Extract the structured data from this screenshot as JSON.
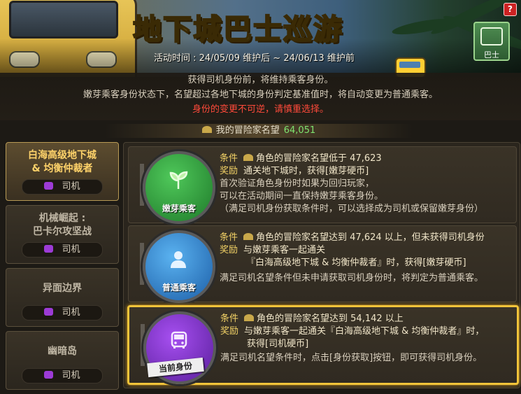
{
  "banner": {
    "title_part1": "地下城",
    "title_part2": "巴士",
    "title_part3": "巡游",
    "period": "活动时间 : 24/05/09 维护后 ~ 24/06/13 维护前",
    "help_label": "?",
    "bus_button_label": "巴士"
  },
  "notice": {
    "line1": "获得司机身份前，将维持乘客身份。",
    "line2": "嫩芽乘客身份状态下，名望超过各地下城的身份判定基准值时，将自动变更为普通乘客。",
    "line3_warning": "身份的变更不可逆，请慎重选择。"
  },
  "reputation": {
    "label": "我的冒险家名望",
    "value": "64,051"
  },
  "sidebar": {
    "items": [
      {
        "line1": "白海高级地下城",
        "line2": "& 均衡仲裁者",
        "role": "司机",
        "active": true
      },
      {
        "line1": "机械崛起 :",
        "line2": "巴卡尔攻坚战",
        "role": "司机",
        "active": false
      },
      {
        "line1": "异面边界",
        "line2": "",
        "role": "司机",
        "active": false
      },
      {
        "line1": "幽暗岛",
        "line2": "",
        "role": "司机",
        "active": false
      }
    ]
  },
  "cards": [
    {
      "badge_label": "嫩芽乘客",
      "color": "#2f9a3a",
      "condition_label": "条件",
      "condition_text": "角色的冒险家名望低于 47,623",
      "reward_label": "奖励",
      "reward_text": "通关地下城时，获得[嫩芽硬币]",
      "extra": [
        "首次验证角色身份时如果为回归玩家，",
        "可以在活动期间一直保持嫩芽乘客身份。",
        "（满足司机身份获取条件时，可以选择成为司机或保留嫩芽身份）"
      ]
    },
    {
      "badge_label": "普通乘客",
      "color": "#2a7fd0",
      "condition_label": "条件",
      "condition_text": "角色的冒险家名望达到 47,624 以上，但未获得司机身份",
      "reward_label": "奖励",
      "reward_text": "与嫩芽乘客一起通关",
      "reward_text2": "『白海高级地下城 & 均衡仲裁者』时，获得[嫩芽硬币]",
      "extra": [
        "满足司机名望条件但未申请获取司机身份时，将判定为普通乘客。"
      ]
    },
    {
      "badge_label": "当前身份",
      "color": "#7a2fc6",
      "current": true,
      "condition_label": "条件",
      "condition_text": "角色的冒险家名望达到 54,142 以上",
      "reward_label": "奖励",
      "reward_text": "与嫩芽乘客一起通关『白海高级地下城 & 均衡仲裁者』时，",
      "reward_text2": "获得[司机硬币]",
      "extra": [
        "满足司机名望条件时，点击[身份获取]按钮，即可获得司机身份。"
      ]
    }
  ]
}
